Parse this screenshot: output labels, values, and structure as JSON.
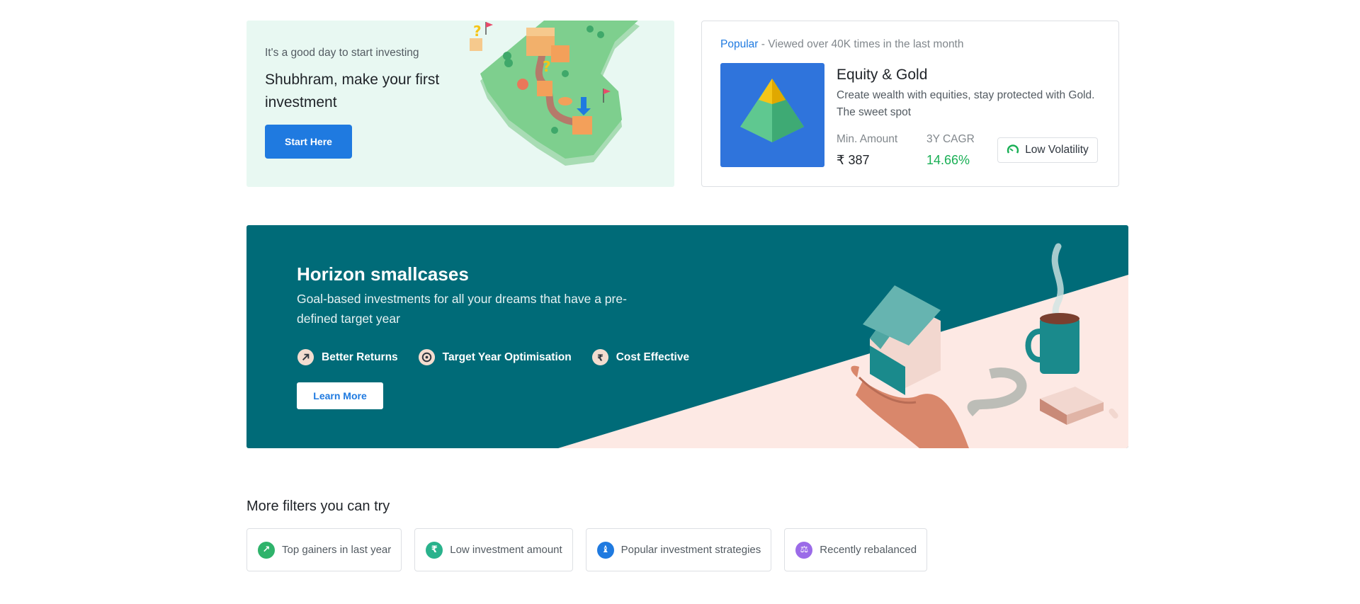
{
  "start_card": {
    "tagline": "It's a good day to start investing",
    "headline": "Shubhram, make your first investment",
    "cta_label": "Start Here",
    "illustration": "island-map-illustration"
  },
  "popular_card": {
    "highlight": "Popular",
    "meta": " - Viewed over 40K times in the last month",
    "thumbnail_icon": "pyramid-icon",
    "name": "Equity & Gold",
    "description": "Create wealth with equities, stay protected with Gold. The sweet spot",
    "min_amount_label": "Min. Amount",
    "min_amount_value": "₹ 387",
    "cagr_label": "3Y CAGR",
    "cagr_value": "14.66%",
    "volatility_label": "Low Volatility",
    "volatility_icon": "speedometer-icon"
  },
  "horizon": {
    "title": "Horizon smallcases",
    "subtitle": "Goal-based investments for all your dreams that have a pre-defined target year",
    "features": [
      {
        "label": "Better Returns",
        "icon": "arrow-up-right-icon"
      },
      {
        "label": "Target Year Optimisation",
        "icon": "target-icon"
      },
      {
        "label": "Cost Effective",
        "icon": "rupee-icon"
      }
    ],
    "learn_more_label": "Learn More",
    "illustration": "house-in-hand-illustration"
  },
  "filters": {
    "heading": "More filters you can try",
    "items": [
      {
        "label": "Top gainers in last year",
        "icon": "arrow-up-right-icon",
        "color": "#2fb36b"
      },
      {
        "label": "Low investment amount",
        "icon": "rupee-icon",
        "color": "#29b28c"
      },
      {
        "label": "Popular investment strategies",
        "icon": "chess-icon",
        "color": "#1f7ae0"
      },
      {
        "label": "Recently rebalanced",
        "icon": "scale-icon",
        "color": "#9b6be8"
      }
    ]
  },
  "colors": {
    "brand_blue": "#1f7ae0",
    "horizon_teal": "#006b78",
    "start_card_bg": "#e8f8f2",
    "positive_green": "#19af55"
  }
}
